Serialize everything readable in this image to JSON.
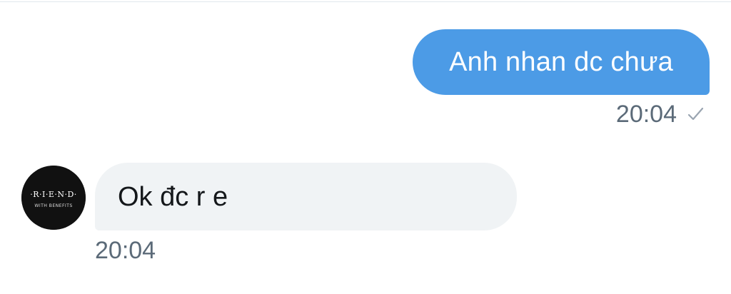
{
  "conversation": {
    "sent_message": {
      "text": "Anh nhan dc chưa",
      "time": "20:04",
      "status_icon": "single-check-icon",
      "bubble_color": "#4c9be6"
    },
    "received_message": {
      "text": "Ok đc r e",
      "time": "20:04",
      "bubble_color": "#f0f3f5",
      "avatar": {
        "icon": "friends-with-benefits-logo",
        "text_line1": "·R·I·E·N·D·",
        "text_line2": "WITH BENEFITS"
      }
    }
  }
}
